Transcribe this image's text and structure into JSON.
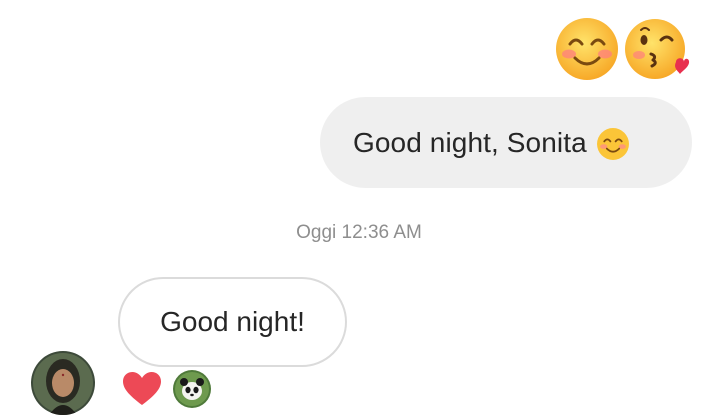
{
  "chat": {
    "big_emojis": [
      "smiling-face-with-smiling-eyes-icon",
      "face-blowing-kiss-icon"
    ],
    "outgoing_message": "Good night, Sonita",
    "outgoing_inline_emoji": "smiling-face-with-smiling-eyes-icon",
    "timestamp": "Oggi 12:36 AM",
    "incoming_message": "Good night!",
    "reaction": "heart-icon",
    "colors": {
      "outgoing_bubble": "#efefef",
      "incoming_border": "#dbdbdb",
      "timestamp": "#8e8e8e",
      "heart": "#ed4956"
    }
  }
}
